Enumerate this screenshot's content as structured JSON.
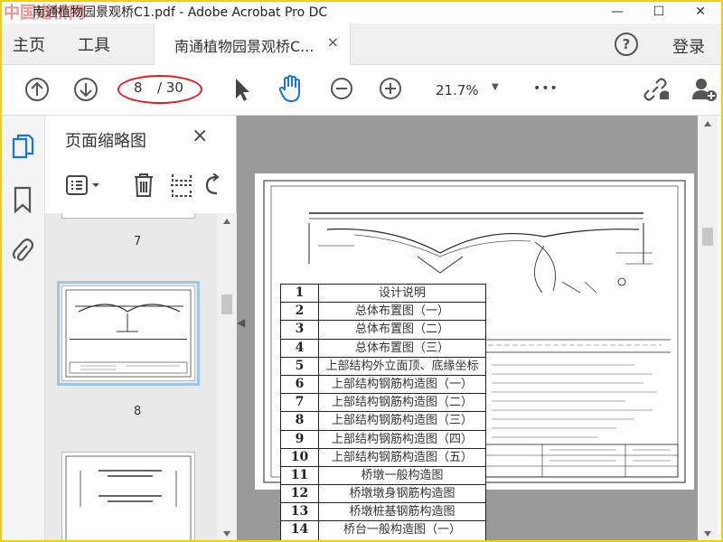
{
  "window": {
    "logo_text": "中国道桥网",
    "title": "南通植物园景观桥C1.pdf - Adobe Acrobat Pro DC",
    "minimize": "—",
    "maximize": "☐",
    "close": "✕"
  },
  "menu": {
    "home": "主页",
    "tools": "工具",
    "doc_tab_label": "南通植物园景观桥C...",
    "doc_tab_close": "×",
    "help": "?",
    "login": "登录"
  },
  "toolbar": {
    "current_page": "8",
    "total_pages": "/ 30",
    "zoom": "21.7%",
    "more": "•••"
  },
  "thumbnails_panel": {
    "title": "页面缩略图",
    "close": "×",
    "labels": [
      "7",
      "8"
    ]
  },
  "drawing_list": [
    {
      "num": "1",
      "name": "设计说明"
    },
    {
      "num": "2",
      "name": "总体布置图（一）"
    },
    {
      "num": "3",
      "name": "总体布置图（二）"
    },
    {
      "num": "4",
      "name": "总体布置图（三）"
    },
    {
      "num": "5",
      "name": "上部结构外立面顶、底缘坐标"
    },
    {
      "num": "6",
      "name": "上部结构钢筋构造图（一）"
    },
    {
      "num": "7",
      "name": "上部结构钢筋构造图（二）"
    },
    {
      "num": "8",
      "name": "上部结构钢筋构造图（三）"
    },
    {
      "num": "9",
      "name": "上部结构钢筋构造图（四）"
    },
    {
      "num": "10",
      "name": "上部结构钢筋构造图（五）"
    },
    {
      "num": "11",
      "name": "桥墩一般构造图"
    },
    {
      "num": "12",
      "name": "桥墩墩身钢筋构造图"
    },
    {
      "num": "13",
      "name": "桥墩桩基钢筋构造图"
    },
    {
      "num": "14",
      "name": "桥台一般构造图（一）"
    }
  ],
  "colors": {
    "accent_blue": "#1473e6",
    "highlight_red": "#e02020",
    "doc_bg": "#9a9a9a"
  }
}
